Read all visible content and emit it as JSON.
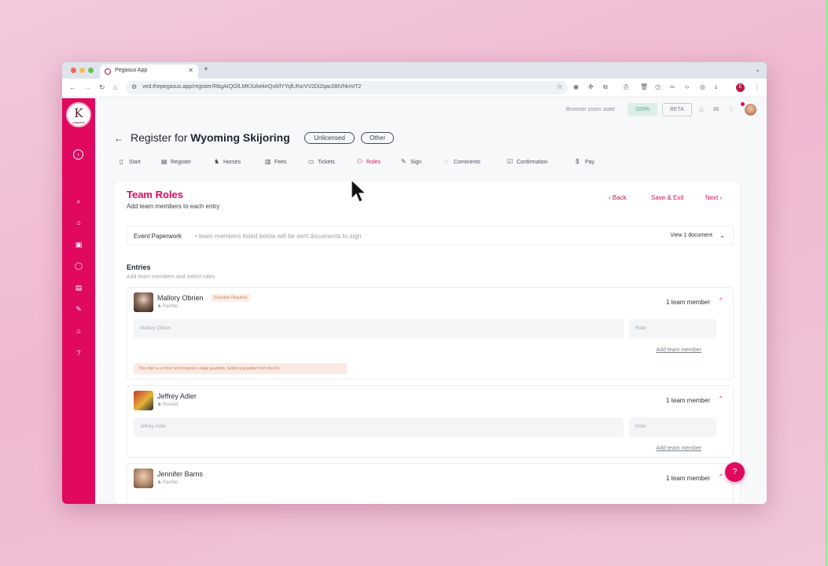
{
  "browser": {
    "tab_title": "Pegasus App",
    "new_tab": "+",
    "url": "ved.thepegasus.app/register/RbgAIQGfLMKXzkekeQv8/lYYqfLRsrVV2Di2qac08tVhkmIT2",
    "profile_initial": "E"
  },
  "app": {
    "logo_text": "K",
    "logo_sub": "pegasus",
    "zoom_label": "Browser zoom state",
    "zoom_value": "100%",
    "beta_label": "BETA"
  },
  "header": {
    "title_prefix": "Register for",
    "event_name": "Wyoming Skijoring",
    "chip_1": "Unlicensed",
    "chip_2": "Other"
  },
  "steps": [
    {
      "label": "Start",
      "icon": "clipboard-icon"
    },
    {
      "label": "Register",
      "icon": "clipboard-list-icon"
    },
    {
      "label": "Horses",
      "icon": "horse-icon"
    },
    {
      "label": "Fees",
      "icon": "receipt-icon"
    },
    {
      "label": "Tickets",
      "icon": "ticket-icon"
    },
    {
      "label": "Roles",
      "icon": "team-icon"
    },
    {
      "label": "Sign",
      "icon": "pen-icon"
    },
    {
      "label": "Comments",
      "icon": "comment-icon"
    },
    {
      "label": "Confirmation",
      "icon": "check-clipboard-icon"
    },
    {
      "label": "Pay",
      "icon": "dollar-icon"
    }
  ],
  "card": {
    "title": "Team Roles",
    "subtitle": "Add team members to each entry",
    "back": "Back",
    "save_exit": "Save & Exit",
    "next": "Next"
  },
  "paperwork": {
    "label": "Event Paperwork",
    "desc": "• team members listed below will be sent documents to sign",
    "view": "View 1 document"
  },
  "entries": {
    "title": "Entries",
    "subtitle": "Add team members and select roles",
    "items": [
      {
        "name": "Mallory Obrien",
        "badge": "Guardian Required",
        "horse": "Rambo",
        "count": "1 team member",
        "member": "Mallory Obrien",
        "role": "Rider",
        "add": "Add team member",
        "warning": "This rider is a minor and requires a legal guardian. Select a guardian from the list."
      },
      {
        "name": "Jeffrey Adler",
        "horse": "Ronald",
        "count": "1 team member",
        "member": "Jeffrey Adler",
        "role": "Rider",
        "add": "Add team member"
      },
      {
        "name": "Jennifer Barns",
        "horse": "Rambo",
        "count": "1 team member"
      }
    ]
  },
  "colors": {
    "brand": "#e0095f",
    "page_bg": "#f7f8fa"
  }
}
